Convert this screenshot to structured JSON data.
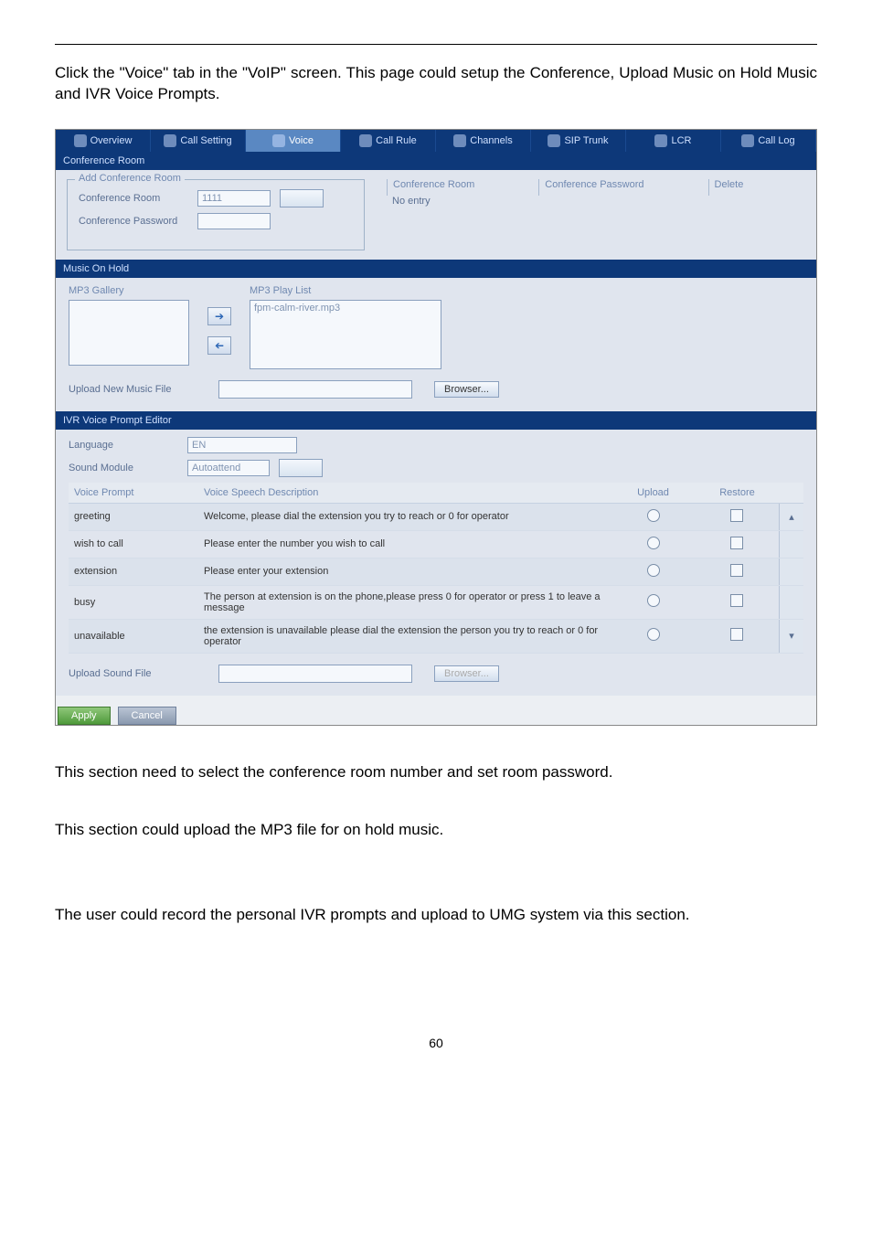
{
  "intro": "Click the \"Voice\" tab in the \"VoIP\" screen. This page could setup the Conference, Upload Music on Hold Music and IVR Voice Prompts.",
  "tabs": [
    "Overview",
    "Call Setting",
    "Voice",
    "Call Rule",
    "Channels",
    "SIP Trunk",
    "LCR",
    "Call Log"
  ],
  "activeTab": "Voice",
  "conference": {
    "panel_title": "Conference Room",
    "legend": "Add Conference Room",
    "room_label": "Conference Room",
    "room_value": "1111",
    "pw_label": "Conference Password",
    "list_headers": [
      "Conference Room",
      "Conference Password",
      "Delete"
    ],
    "list_entry_room": "No entry"
  },
  "moh": {
    "panel_title": "Music On Hold",
    "gallery_label": "MP3 Gallery",
    "playlist_label": "MP3 Play List",
    "playlist_item": "fpm-calm-river.mp3",
    "upload_label": "Upload New Music File",
    "browser_btn": "Browser..."
  },
  "ivr": {
    "panel_title": "IVR Voice Prompt Editor",
    "language_label": "Language",
    "language_value": "EN",
    "sound_module_label": "Sound Module",
    "sound_module_value": "Autoattend",
    "columns": [
      "Voice Prompt",
      "Voice Speech Description",
      "Upload",
      "Restore"
    ],
    "rows": [
      {
        "prompt": "greeting",
        "desc": "Welcome, please dial the extension you try to reach or 0 for operator"
      },
      {
        "prompt": "wish to call",
        "desc": "Please enter the number you wish to call"
      },
      {
        "prompt": "extension",
        "desc": "Please enter your extension"
      },
      {
        "prompt": "busy",
        "desc": "The person at extension is on the phone,please press 0 for operator or press 1 to leave a message"
      },
      {
        "prompt": "unavailable",
        "desc": "the extension is unavailable please dial the extension the person you try to reach or 0 for operator"
      }
    ],
    "upload_sound_label": "Upload Sound File",
    "browser_btn": "Browser..."
  },
  "buttons": {
    "apply": "Apply",
    "cancel": "Cancel"
  },
  "section1": "This section need to select the conference room number and set room password.",
  "section2": "This section could upload the MP3 file for on hold music.",
  "section3": "The user could record the personal IVR prompts and upload to UMG system via this section.",
  "page_number": "60"
}
